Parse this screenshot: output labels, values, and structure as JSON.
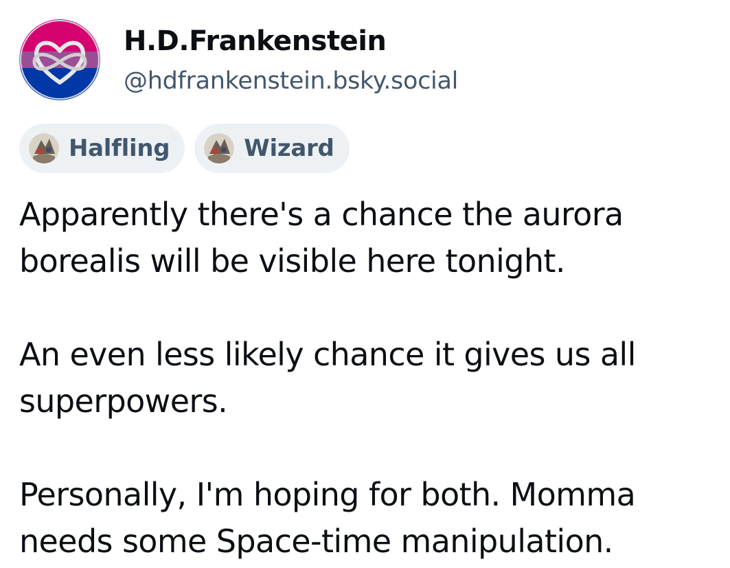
{
  "author": {
    "display_name": "H.D.Frankenstein",
    "handle": "@hdfrankenstein.bsky.social",
    "avatar_icon": "infinity-heart-bi-flag-avatar",
    "avatar_colors": [
      "#d60270",
      "#9b4f96",
      "#0038a8"
    ]
  },
  "labels": [
    {
      "text": "Halfling",
      "icon": "label-badge-icon"
    },
    {
      "text": "Wizard",
      "icon": "label-badge-icon"
    }
  ],
  "post": {
    "paragraphs": [
      "Apparently there's a chance the aurora borealis will be visible here tonight.",
      "An even less likely chance it gives us all superpowers.",
      "Personally, I'm hoping for both. Momma needs some Space-time manipulation."
    ]
  },
  "colors": {
    "text": "#0b0f14",
    "secondary": "#42576c",
    "chip_bg": "#eef1f4"
  }
}
